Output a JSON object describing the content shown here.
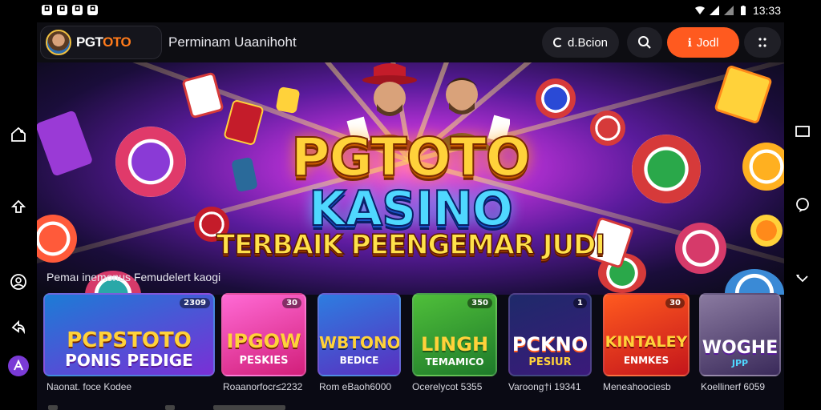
{
  "status_bar": {
    "time": "13:33",
    "left_icons": [
      "notification-icon",
      "notification-icon",
      "notification-icon",
      "notification-icon"
    ],
    "right_icons": [
      "wifi-icon",
      "signal-icon",
      "signal-icon",
      "battery-icon"
    ]
  },
  "header": {
    "logo_pre": "PGT",
    "logo_accent": "OTO",
    "title": "Perminam Uaanihoht",
    "search_text": "d.Bcion",
    "join_label": "Jodl"
  },
  "hero": {
    "line1": "PGTOTO",
    "line2": "KASINO",
    "line3": "TERBAIK PEENGEMAR JUDI"
  },
  "section": {
    "title": "Pemaı inemonus Femudelert kaogi"
  },
  "games": [
    {
      "title": "PCPSTOTO",
      "subtitle": "PONIS PEDIGE",
      "badge": "2309",
      "caption": "Naonat. foce Kodee",
      "colors": [
        "#1c7cd6",
        "#7a2fd6"
      ]
    },
    {
      "title": "IPGOW",
      "subtitle": "PESKIES",
      "badge": "30",
      "caption": "Roaanorfocr≤2232",
      "colors": [
        "#ff6ad5",
        "#d21f7a"
      ]
    },
    {
      "title": "WBTONO",
      "subtitle": "BEDICE",
      "badge": "",
      "caption": "Rom eBaoh6000",
      "colors": [
        "#2d7de0",
        "#5a2fc0"
      ]
    },
    {
      "title": "LINGH",
      "subtitle": "TEMAMICO",
      "badge": "350",
      "caption": "Ocerelycot 5355",
      "colors": [
        "#4fbf3a",
        "#1e7a2a"
      ]
    },
    {
      "title": "PCKNO",
      "subtitle": "PESIUR",
      "badge": "1",
      "caption": "Varoong†i 19341",
      "colors": [
        "#1e2a6a",
        "#3b1a7a"
      ]
    },
    {
      "title": "KINTALEY",
      "subtitle": "ENMKES",
      "badge": "30",
      "caption": "Meneahoociesb",
      "colors": [
        "#ff5a1f",
        "#c4161c"
      ]
    },
    {
      "title": "WOGHE",
      "subtitle": "JPP",
      "badge": "",
      "caption": "Koellinerf 6059",
      "colors": [
        "#8a7aa0",
        "#3a2a5a"
      ]
    }
  ]
}
